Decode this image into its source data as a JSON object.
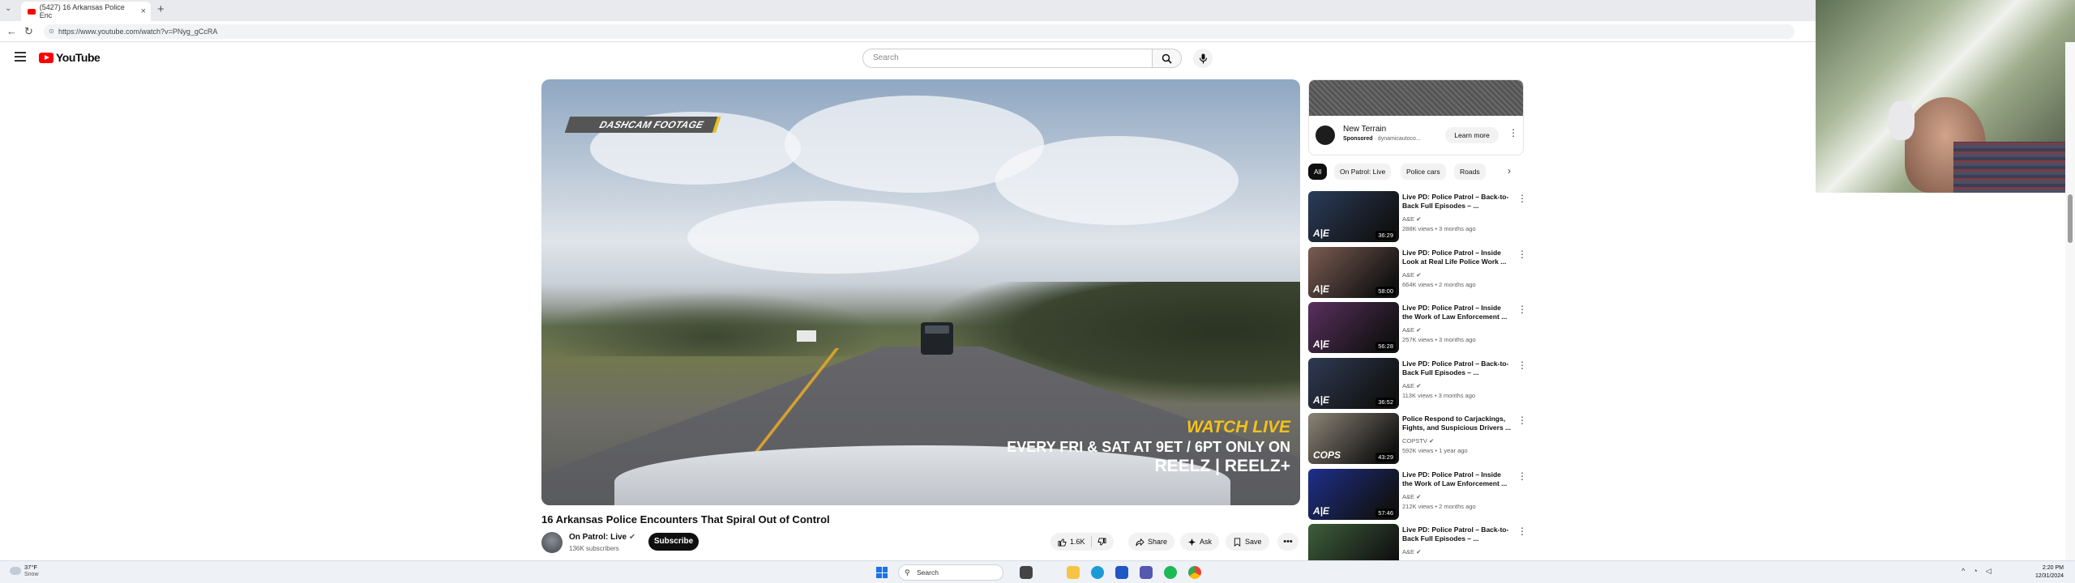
{
  "browser": {
    "tab_title": "(5427) 16 Arkansas Police Enc",
    "url": "https://www.youtube.com/watch?v=PNyg_gCcRA"
  },
  "header": {
    "logo_text": "YouTube",
    "search_placeholder": "Search"
  },
  "video": {
    "overlay_tag": "DASHCAM FOOTAGE",
    "promo_line1": "WATCH LIVE",
    "promo_line2": "EVERY FRI & SAT AT 9ET / 6PT ONLY ON",
    "promo_line3": "REELZ | REELZ+",
    "title": "16 Arkansas Police Encounters That Spiral Out of Control",
    "channel": "On Patrol: Live",
    "subscribers": "136K subscribers",
    "subscribe_label": "Subscribe",
    "likes": "1.6K",
    "share_label": "Share",
    "ask_label": "Ask",
    "save_label": "Save"
  },
  "ad": {
    "title": "New Terrain",
    "sponsored": "Sponsored",
    "domain": "dynamicautoco...",
    "button": "Learn more"
  },
  "chips": [
    "All",
    "On Patrol: Live",
    "Police cars",
    "Roads"
  ],
  "recommendations": [
    {
      "title": "Live PD: Police Patrol – Back-to-Back Full Episodes – ...",
      "channel": "A&E",
      "meta": "288K views • 3 months ago",
      "duration": "36:29",
      "thumb_color": "#2a3c5a"
    },
    {
      "title": "Live PD: Police Patrol – Inside Look at Real Life Police Work ...",
      "channel": "A&E",
      "meta": "664K views • 2 months ago",
      "duration": "58:00",
      "thumb_color": "#7b5c52"
    },
    {
      "title": "Live PD: Police Patrol – Inside the Work of Law Enforcement ...",
      "channel": "A&E",
      "meta": "257K views • 3 months ago",
      "duration": "56:28",
      "thumb_color": "#5a2f5e"
    },
    {
      "title": "Live PD: Police Patrol – Back-to-Back Full Episodes – ...",
      "channel": "A&E",
      "meta": "113K views • 3 months ago",
      "duration": "36:52",
      "thumb_color": "#2e3a53"
    },
    {
      "title": "Police Respond to Carjackings, Fights, and Suspicious Drivers ...",
      "channel": "COPSTV",
      "meta": "592K views • 1 year ago",
      "duration": "43:29",
      "thumb_color": "#8c8476"
    },
    {
      "title": "Live PD: Police Patrol – Inside the Work of Law Enforcement ...",
      "channel": "A&E",
      "meta": "212K views • 2 months ago",
      "duration": "57:46",
      "thumb_color": "#1e2f8a"
    },
    {
      "title": "Live PD: Police Patrol – Back-to-Back Full Episodes – ...",
      "channel": "A&E",
      "meta": "",
      "duration": "",
      "thumb_color": "#3e5e3a"
    }
  ],
  "taskbar": {
    "temperature": "37°F",
    "condition": "Snow",
    "search_label": "Search",
    "time": "2:20 PM",
    "date": "12/31/2024"
  },
  "colors": {
    "brand_red": "#ff0000",
    "subscribe_bg": "#0f0f0f",
    "promo_yellow": "#f4c21b"
  }
}
